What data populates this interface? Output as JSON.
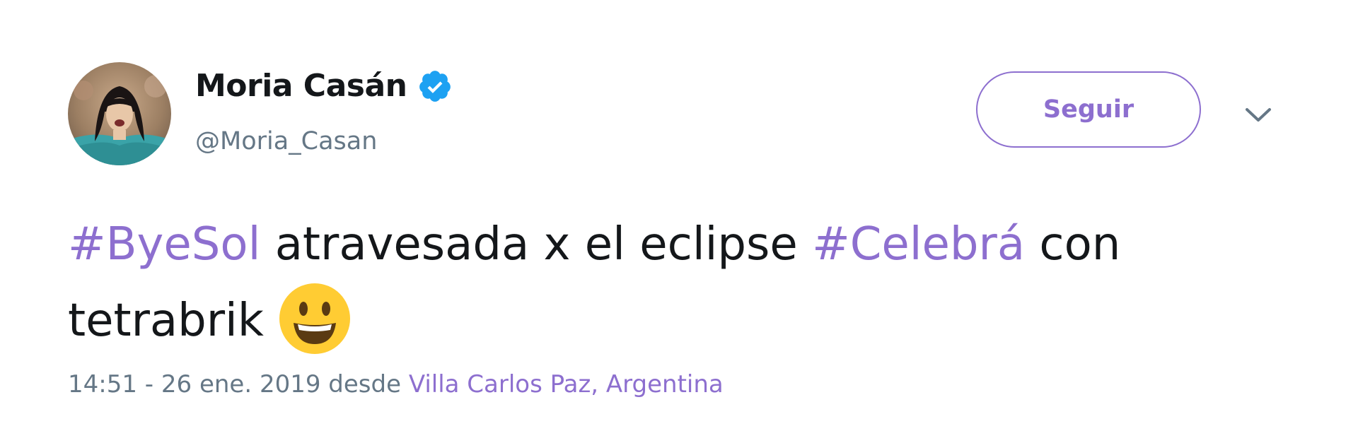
{
  "author": {
    "display_name": "Moria Casán",
    "handle": "@Moria_Casan",
    "verified_icon": "verified-badge-icon"
  },
  "follow_button": {
    "label": "Seguir"
  },
  "menu": {
    "icon": "chevron-down-icon"
  },
  "tweet": {
    "segments": [
      {
        "text": "#ByeSol",
        "type": "hashtag"
      },
      {
        "text": " atravesada x el eclipse ",
        "type": "text"
      },
      {
        "text": "#Celebrá",
        "type": "hashtag"
      },
      {
        "text": " con tetrabrik",
        "type": "text"
      }
    ],
    "emoji": "grinning-face-emoji"
  },
  "meta": {
    "time_date": "14:51 - 26 ene. 2019",
    "via_word": "desde",
    "location": "Villa Carlos Paz, Argentina"
  },
  "colors": {
    "accent": "#8d6fcf",
    "text": "#14171a",
    "secondary": "#657786",
    "verified": "#1da1f2"
  }
}
